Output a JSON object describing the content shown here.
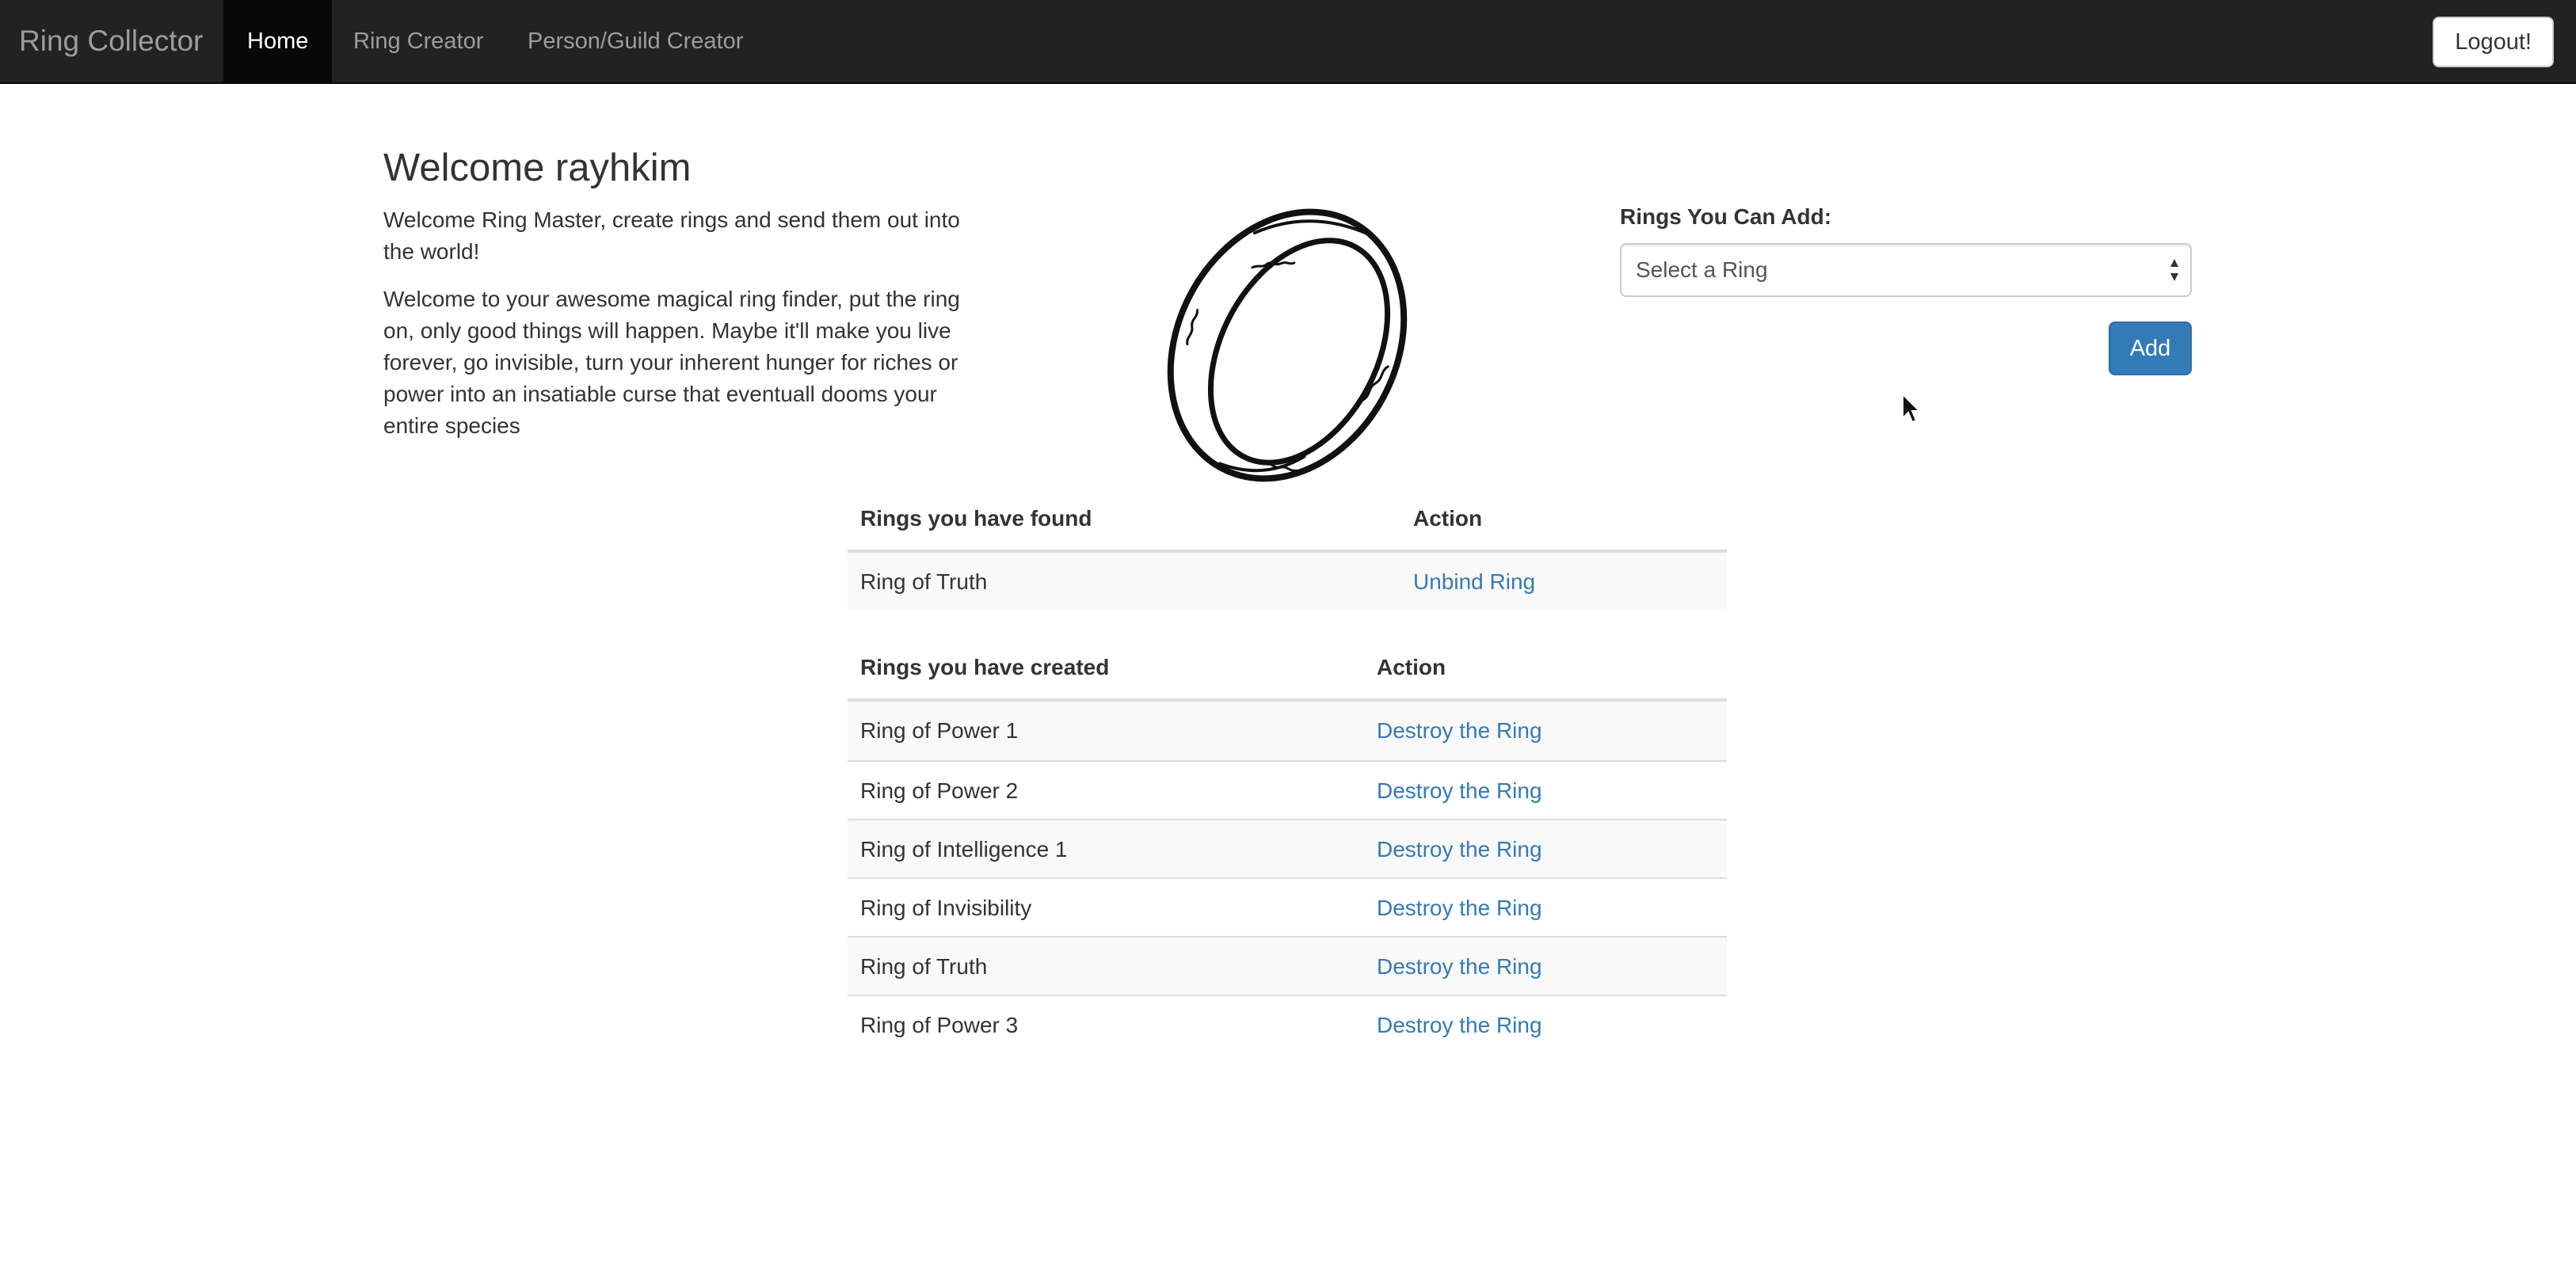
{
  "navbar": {
    "brand": "Ring Collector",
    "items": [
      {
        "label": "Home",
        "active": true
      },
      {
        "label": "Ring Creator",
        "active": false
      },
      {
        "label": "Person/Guild Creator",
        "active": false
      }
    ],
    "logout_label": "Logout!"
  },
  "welcome": {
    "title": "Welcome rayhkim",
    "intro": "Welcome Ring Master, create rings and send them out into the world!",
    "description": "Welcome to your awesome magical ring finder, put the ring on, only good things will happen. Maybe it'll make you live forever, go invisible, turn your inherent hunger for riches or power into an insatiable curse that eventuall dooms your entire species"
  },
  "add_ring_form": {
    "label": "Rings You Can Add:",
    "select_value": "Select a Ring",
    "add_label": "Add"
  },
  "found_table": {
    "headers": [
      "Rings you have found",
      "Action"
    ],
    "rows": [
      {
        "name": "Ring of Truth",
        "action": "Unbind Ring"
      }
    ]
  },
  "created_table": {
    "headers": [
      "Rings you have created",
      "Action"
    ],
    "rows": [
      {
        "name": "Ring of Power 1",
        "action": "Destroy the Ring"
      },
      {
        "name": "Ring of Power 2",
        "action": "Destroy the Ring"
      },
      {
        "name": "Ring of Intelligence 1",
        "action": "Destroy the Ring"
      },
      {
        "name": "Ring of Invisibility",
        "action": "Destroy the Ring"
      },
      {
        "name": "Ring of Truth",
        "action": "Destroy the Ring"
      },
      {
        "name": "Ring of Power 3",
        "action": "Destroy the Ring"
      }
    ]
  },
  "colors": {
    "navbar_bg": "#222222",
    "navbar_active_bg": "#080808",
    "link": "#337ab7",
    "primary_button": "#337ab7"
  },
  "icons": {
    "ring_image": "one-ring-image",
    "select_arrows": "select-arrows-icon",
    "cursor": "mouse-cursor-icon"
  }
}
